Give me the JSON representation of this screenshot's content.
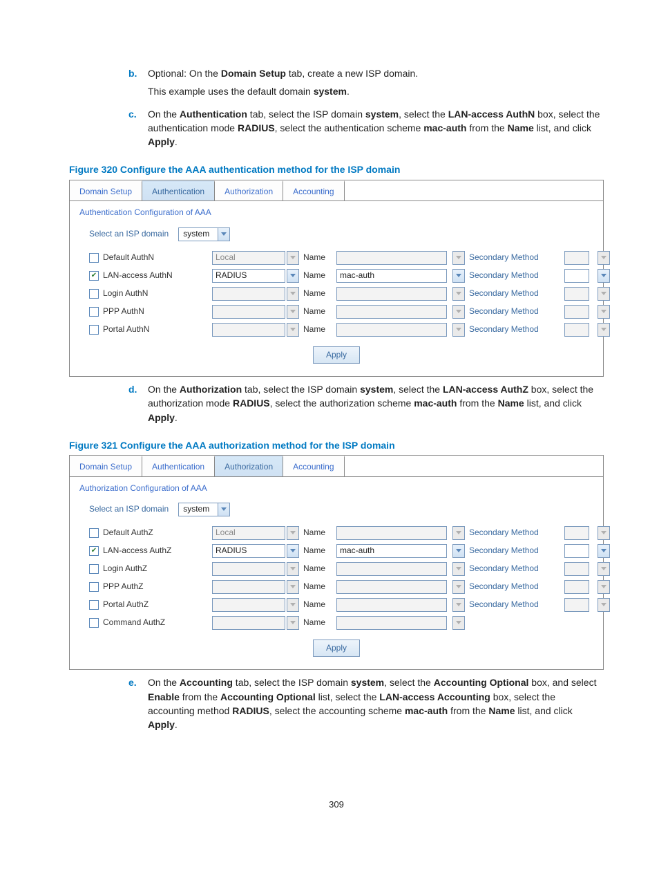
{
  "steps": {
    "b": {
      "marker": "b.",
      "line1_pre": "Optional: On the ",
      "line1_strong1": "Domain Setup",
      "line1_post": " tab, create a new ISP domain.",
      "line2_pre": "This example uses the default domain ",
      "line2_strong": "system",
      "line2_post": "."
    },
    "c": {
      "marker": "c.",
      "t1": "On the ",
      "s1": "Authentication",
      "t2": " tab, select the ISP domain ",
      "s2": "system",
      "t3": ", select the ",
      "s3": "LAN-access AuthN",
      "t4": " box, select the authentication mode ",
      "s4": "RADIUS",
      "t5": ", select the authentication scheme ",
      "s5": "mac-auth",
      "t6": " from the ",
      "s6": "Name",
      "t7": " list, and click ",
      "s7": "Apply",
      "t8": "."
    },
    "d": {
      "marker": "d.",
      "t1": "On the ",
      "s1": "Authorization",
      "t2": " tab, select the ISP domain ",
      "s2": "system",
      "t3": ", select the ",
      "s3": "LAN-access AuthZ",
      "t4": " box, select the authorization mode ",
      "s4": "RADIUS",
      "t5": ", select the authorization scheme ",
      "s5": "mac-auth",
      "t6": " from the ",
      "s6": "Name",
      "t7": " list, and click ",
      "s7": "Apply",
      "t8": "."
    },
    "e": {
      "marker": "e.",
      "t1": "On the ",
      "s1": "Accounting",
      "t2": " tab, select the ISP domain ",
      "s2": "system",
      "t3": ", select the ",
      "s3": "Accounting Optional",
      "t4": " box, and select ",
      "s4": "Enable",
      "t5": " from the ",
      "s5": "Accounting Optional",
      "t6": " list, select the ",
      "s6": "LAN-access Accounting",
      "t7": " box, select the accounting method ",
      "s7": "RADIUS",
      "t8": ", select the accounting scheme ",
      "s8": "mac-auth",
      "t9": " from the ",
      "s9": "Name",
      "t10": " list, and click ",
      "s10": "Apply",
      "t11": "."
    }
  },
  "fig320": {
    "caption": "Figure 320 Configure the AAA authentication method for the ISP domain",
    "tabs": [
      "Domain Setup",
      "Authentication",
      "Authorization",
      "Accounting"
    ],
    "activeTab": 1,
    "sectionTitle": "Authentication Configuration of AAA",
    "selectLabel": "Select an ISP domain",
    "domainValue": "system",
    "nameCol": "Name",
    "secondary": "Secondary Method",
    "apply": "Apply",
    "rows": [
      {
        "label": "Default AuthN",
        "checked": false,
        "mode": "Local",
        "name": "",
        "enabled": false,
        "hasSecondary": true
      },
      {
        "label": "LAN-access AuthN",
        "checked": true,
        "mode": "RADIUS",
        "name": "mac-auth",
        "enabled": true,
        "hasSecondary": true
      },
      {
        "label": "Login AuthN",
        "checked": false,
        "mode": "",
        "name": "",
        "enabled": false,
        "hasSecondary": true
      },
      {
        "label": "PPP AuthN",
        "checked": false,
        "mode": "",
        "name": "",
        "enabled": false,
        "hasSecondary": true
      },
      {
        "label": "Portal AuthN",
        "checked": false,
        "mode": "",
        "name": "",
        "enabled": false,
        "hasSecondary": true
      }
    ]
  },
  "fig321": {
    "caption": "Figure 321 Configure the AAA authorization method for the ISP domain",
    "tabs": [
      "Domain Setup",
      "Authentication",
      "Authorization",
      "Accounting"
    ],
    "activeTab": 2,
    "sectionTitle": "Authorization Configuration of AAA",
    "selectLabel": "Select an ISP domain",
    "domainValue": "system",
    "nameCol": "Name",
    "secondary": "Secondary Method",
    "apply": "Apply",
    "rows": [
      {
        "label": "Default AuthZ",
        "checked": false,
        "mode": "Local",
        "name": "",
        "enabled": false,
        "hasSecondary": true
      },
      {
        "label": "LAN-access AuthZ",
        "checked": true,
        "mode": "RADIUS",
        "name": "mac-auth",
        "enabled": true,
        "hasSecondary": true
      },
      {
        "label": "Login AuthZ",
        "checked": false,
        "mode": "",
        "name": "",
        "enabled": false,
        "hasSecondary": true
      },
      {
        "label": "PPP AuthZ",
        "checked": false,
        "mode": "",
        "name": "",
        "enabled": false,
        "hasSecondary": true
      },
      {
        "label": "Portal AuthZ",
        "checked": false,
        "mode": "",
        "name": "",
        "enabled": false,
        "hasSecondary": true
      },
      {
        "label": "Command AuthZ",
        "checked": false,
        "mode": "",
        "name": "",
        "enabled": false,
        "hasSecondary": false
      }
    ]
  },
  "pageNumber": "309"
}
